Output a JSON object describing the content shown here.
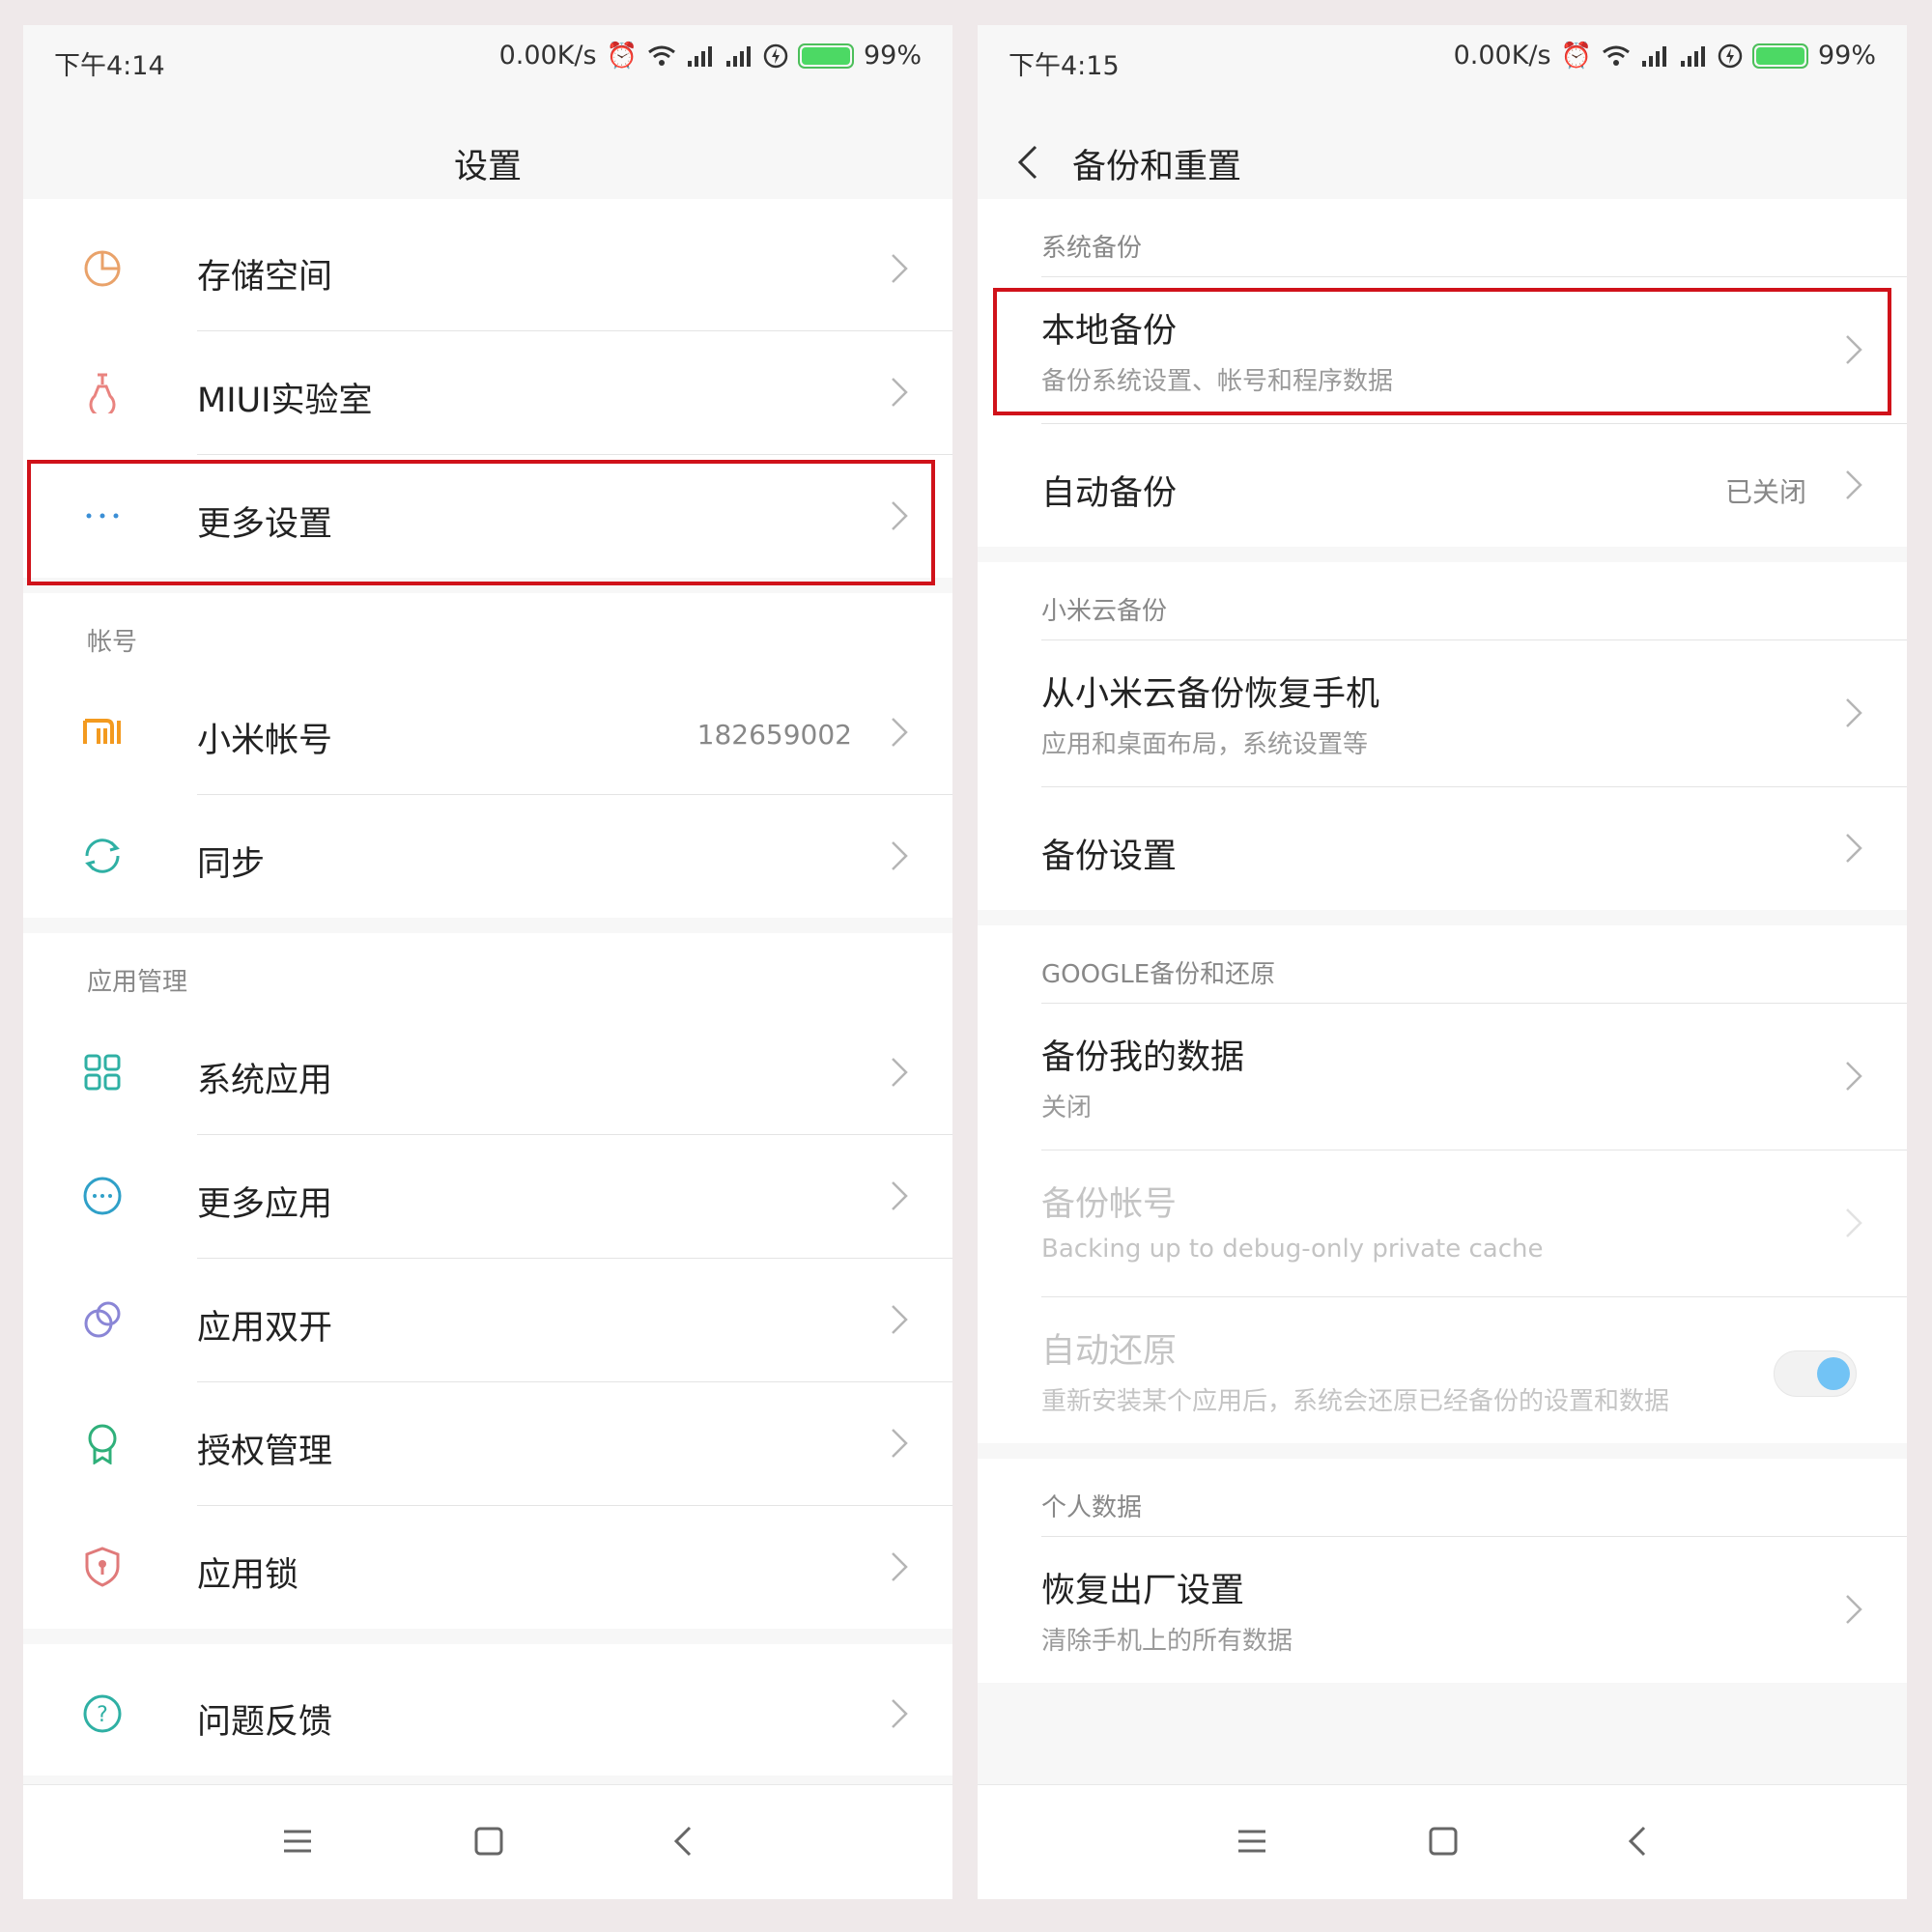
{
  "left": {
    "status": {
      "time": "下午4:14",
      "speed": "0.00K/s",
      "battery": "99%"
    },
    "title": "设置",
    "group1": [
      {
        "label": "存储空间"
      },
      {
        "label": "MIUI实验室"
      },
      {
        "label": "更多设置"
      }
    ],
    "account": {
      "header": "帐号",
      "items": [
        {
          "label": "小米帐号",
          "value": "182659002"
        },
        {
          "label": "同步"
        }
      ]
    },
    "apps": {
      "header": "应用管理",
      "items": [
        {
          "label": "系统应用"
        },
        {
          "label": "更多应用"
        },
        {
          "label": "应用双开"
        },
        {
          "label": "授权管理"
        },
        {
          "label": "应用锁"
        }
      ]
    },
    "feedback": {
      "label": "问题反馈"
    }
  },
  "right": {
    "status": {
      "time": "下午4:15",
      "speed": "0.00K/s",
      "battery": "99%"
    },
    "title": "备份和重置",
    "system_backup": {
      "header": "系统备份",
      "items": [
        {
          "label": "本地备份",
          "sub": "备份系统设置、帐号和程序数据"
        },
        {
          "label": "自动备份",
          "value": "已关闭"
        }
      ]
    },
    "cloud_backup": {
      "header": "小米云备份",
      "items": [
        {
          "label": "从小米云备份恢复手机",
          "sub": "应用和桌面布局，系统设置等"
        },
        {
          "label": "备份设置"
        }
      ]
    },
    "google_backup": {
      "header": "GOOGLE备份和还原",
      "items": [
        {
          "label": "备份我的数据",
          "sub": "关闭"
        },
        {
          "label": "备份帐号",
          "sub": "Backing up to debug-only private cache"
        },
        {
          "label": "自动还原",
          "sub": "重新安装某个应用后，系统会还原已经备份的设置和数据"
        }
      ]
    },
    "personal": {
      "header": "个人数据",
      "items": [
        {
          "label": "恢复出厂设置",
          "sub": "清除手机上的所有数据"
        }
      ]
    }
  },
  "colors": {
    "highlight": "#d0121a",
    "toggle_on": "#72c3f5",
    "battery": "#4cd964"
  }
}
